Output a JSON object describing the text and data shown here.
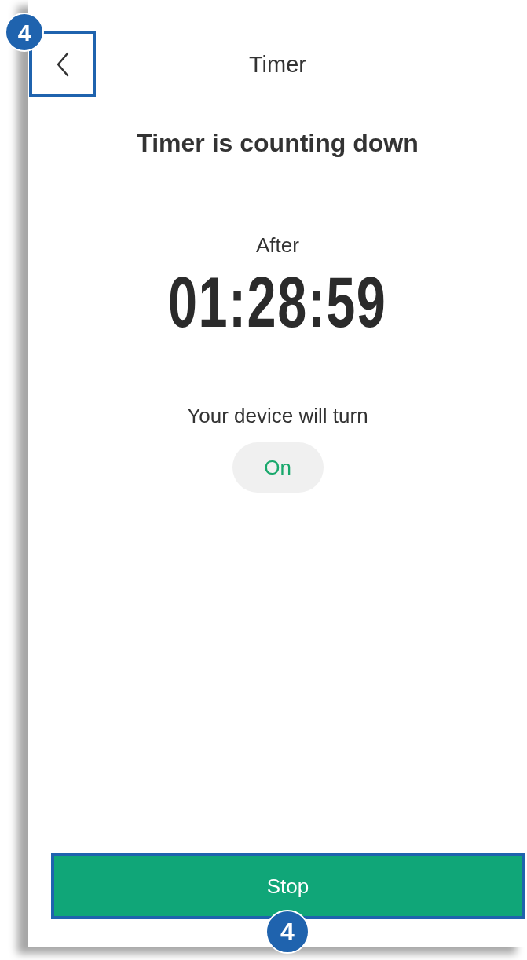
{
  "header": {
    "title": "Timer",
    "back_callout": "4"
  },
  "heading": "Timer is counting down",
  "countdown": {
    "label": "After",
    "time": "01:28:59"
  },
  "action": {
    "label": "Your device will turn",
    "state": "On"
  },
  "button": {
    "label": "Stop",
    "callout": "4"
  }
}
